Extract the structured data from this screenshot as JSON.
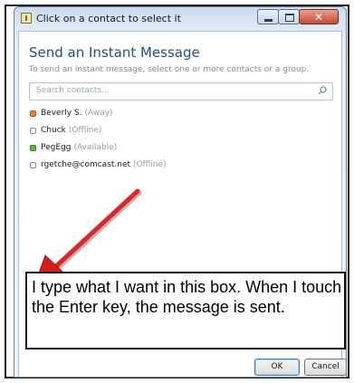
{
  "window": {
    "title": "Click on a contact to select it"
  },
  "dialog": {
    "heading": "Send an Instant Message",
    "instructions": "To send an instant message, select one or more contacts or a group.",
    "search_placeholder": "Search contacts..."
  },
  "contacts": [
    {
      "name": "Beverly S.",
      "status": "(Away)",
      "status_color": "#e8862b"
    },
    {
      "name": "Chuck",
      "status": "(Offline)",
      "status_color": "#ffffff"
    },
    {
      "name": "PegEgg",
      "status": "(Available)",
      "status_color": "#5cb83a"
    },
    {
      "name": "rgetche@comcast.net",
      "status": "(Offline)",
      "status_color": "#ffffff"
    }
  ],
  "annotation": {
    "text": "I type what I want in this box.  When I touch the Enter key, the message is sent.",
    "arrow_color": "#e01b1b"
  },
  "buttons": {
    "ok": "OK",
    "cancel": "Cancel"
  },
  "colors": {
    "heading": "#1e4e8c",
    "window_chrome": "#c9dcf0",
    "close_button": "#c64a31"
  }
}
